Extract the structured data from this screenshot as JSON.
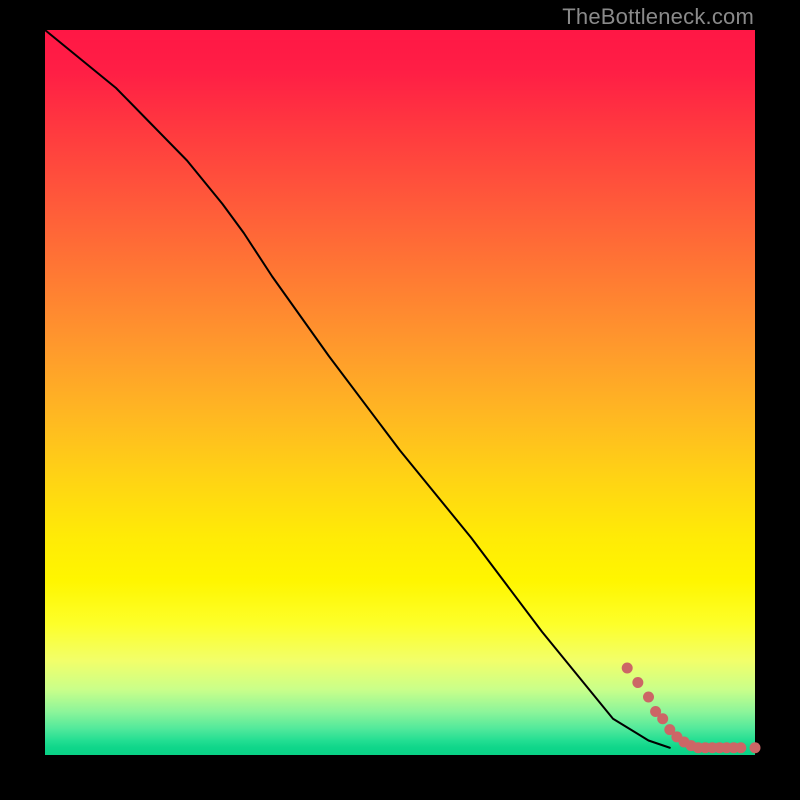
{
  "watermark": "TheBottleneck.com",
  "chart_data": {
    "type": "line",
    "title": "",
    "xlabel": "",
    "ylabel": "",
    "xlim": [
      0,
      100
    ],
    "ylim": [
      0,
      100
    ],
    "grid": false,
    "series": [
      {
        "name": "curve",
        "style": "line",
        "color": "#000000",
        "x": [
          0,
          5,
          10,
          15,
          20,
          25,
          28,
          32,
          40,
          50,
          60,
          70,
          80,
          85,
          88
        ],
        "y": [
          100,
          96,
          92,
          87,
          82,
          76,
          72,
          66,
          55,
          42,
          30,
          17,
          5,
          2,
          1
        ]
      },
      {
        "name": "dots",
        "style": "points",
        "color": "#cc6666",
        "x": [
          82,
          83.5,
          85,
          86,
          87,
          88,
          89,
          90,
          91,
          92,
          93,
          94,
          95,
          96,
          97,
          98,
          100
        ],
        "y": [
          12,
          10,
          8,
          6,
          5,
          3.5,
          2.5,
          1.8,
          1.3,
          1.0,
          1.0,
          1.0,
          1.0,
          1.0,
          1.0,
          1.0,
          1.0
        ]
      }
    ]
  }
}
